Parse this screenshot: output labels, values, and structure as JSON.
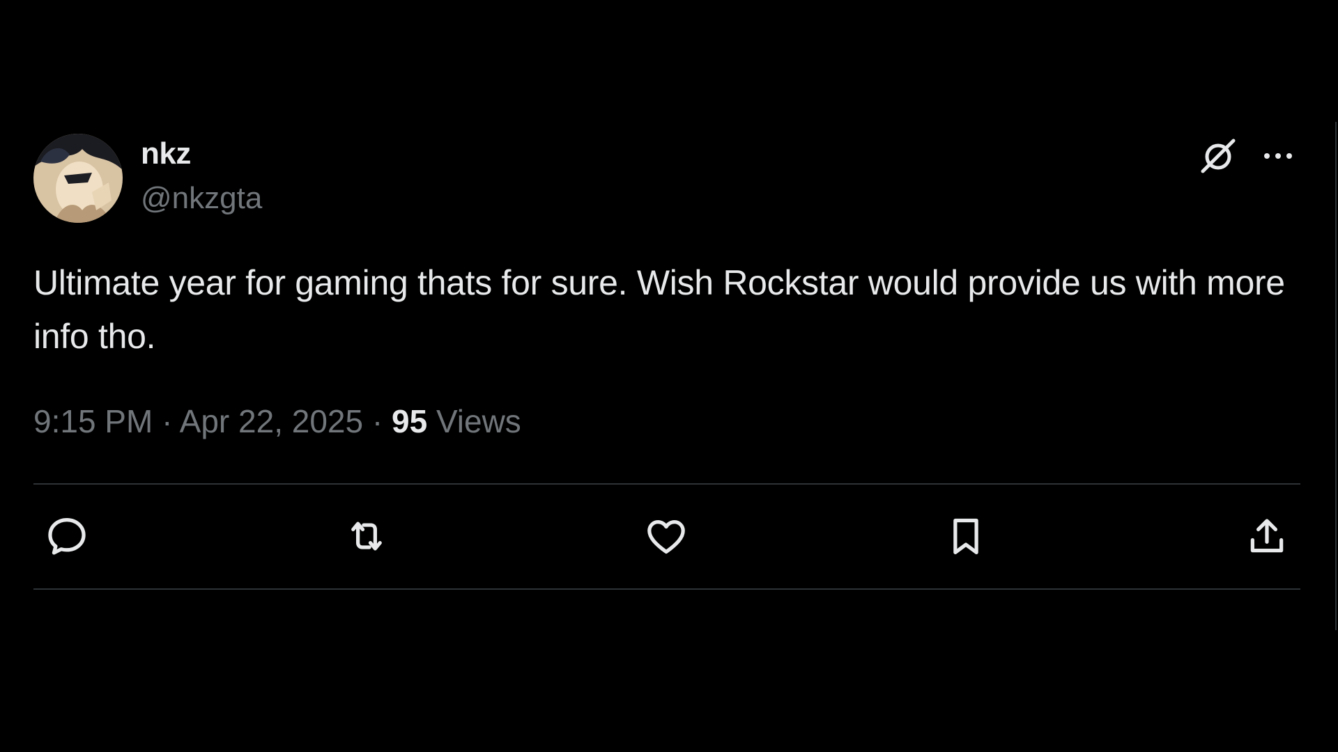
{
  "tweet": {
    "author": {
      "display_name": "nkz",
      "handle": "@nkzgta",
      "avatar_icon": "avatar-icon"
    },
    "text": "Ultimate year for gaming thats for sure. Wish Rockstar would provide us with more info tho.",
    "time": "9:15 PM",
    "separator": "·",
    "date": "Apr 22, 2025",
    "views_count": "95",
    "views_label": "Views"
  },
  "header_actions": {
    "grok_icon": "grok-icon",
    "more_icon": "more-icon"
  },
  "actions": [
    {
      "name": "reply",
      "icon": "reply-icon"
    },
    {
      "name": "repost",
      "icon": "repost-icon"
    },
    {
      "name": "like",
      "icon": "heart-icon"
    },
    {
      "name": "bookmark",
      "icon": "bookmark-icon"
    },
    {
      "name": "share",
      "icon": "share-icon"
    }
  ],
  "colors": {
    "background": "#000000",
    "primary_text": "#e7e9ea",
    "secondary_text": "#71767b",
    "divider": "#2f3336"
  }
}
